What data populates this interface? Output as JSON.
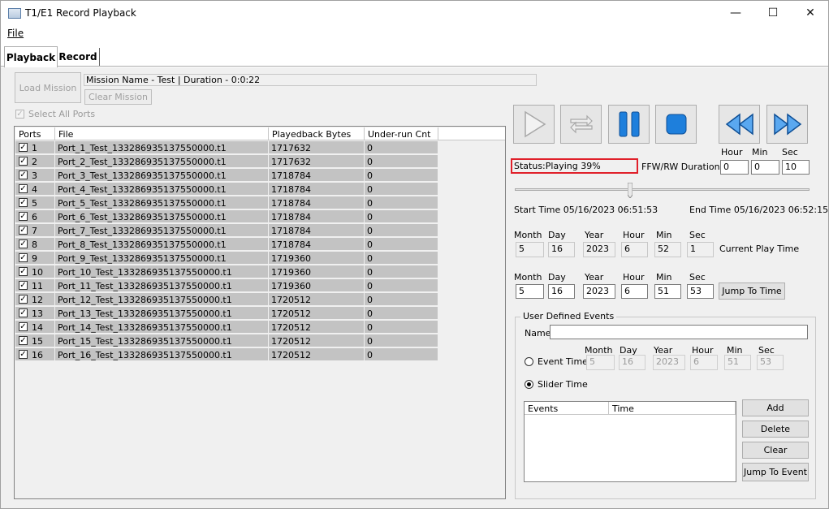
{
  "window": {
    "title": "T1/E1 Record Playback",
    "minimize": "—",
    "maximize": "☐",
    "close": "✕"
  },
  "menu": {
    "file": "File"
  },
  "tabs": [
    {
      "label": "Playback"
    },
    {
      "label": "Record"
    }
  ],
  "mission": {
    "load_button": "Load Mission",
    "info": "Mission Name - Test | Duration - 0:0:22",
    "clear_button": "Clear Mission",
    "select_all": "Select All Ports"
  },
  "ports_table": {
    "columns": [
      "Ports",
      "File",
      "Playedback Bytes",
      "Under-run Cnt"
    ],
    "rows": [
      {
        "port": "1",
        "file": "Port_1_Test_133286935137550000.t1",
        "bytes": "1717632",
        "underrun": "0"
      },
      {
        "port": "2",
        "file": "Port_2_Test_133286935137550000.t1",
        "bytes": "1717632",
        "underrun": "0"
      },
      {
        "port": "3",
        "file": "Port_3_Test_133286935137550000.t1",
        "bytes": "1718784",
        "underrun": "0"
      },
      {
        "port": "4",
        "file": "Port_4_Test_133286935137550000.t1",
        "bytes": "1718784",
        "underrun": "0"
      },
      {
        "port": "5",
        "file": "Port_5_Test_133286935137550000.t1",
        "bytes": "1718784",
        "underrun": "0"
      },
      {
        "port": "6",
        "file": "Port_6_Test_133286935137550000.t1",
        "bytes": "1718784",
        "underrun": "0"
      },
      {
        "port": "7",
        "file": "Port_7_Test_133286935137550000.t1",
        "bytes": "1718784",
        "underrun": "0"
      },
      {
        "port": "8",
        "file": "Port_8_Test_133286935137550000.t1",
        "bytes": "1718784",
        "underrun": "0"
      },
      {
        "port": "9",
        "file": "Port_9_Test_133286935137550000.t1",
        "bytes": "1719360",
        "underrun": "0"
      },
      {
        "port": "10",
        "file": "Port_10_Test_133286935137550000.t1",
        "bytes": "1719360",
        "underrun": "0"
      },
      {
        "port": "11",
        "file": "Port_11_Test_133286935137550000.t1",
        "bytes": "1719360",
        "underrun": "0"
      },
      {
        "port": "12",
        "file": "Port_12_Test_133286935137550000.t1",
        "bytes": "1720512",
        "underrun": "0"
      },
      {
        "port": "13",
        "file": "Port_13_Test_133286935137550000.t1",
        "bytes": "1720512",
        "underrun": "0"
      },
      {
        "port": "14",
        "file": "Port_14_Test_133286935137550000.t1",
        "bytes": "1720512",
        "underrun": "0"
      },
      {
        "port": "15",
        "file": "Port_15_Test_133286935137550000.t1",
        "bytes": "1720512",
        "underrun": "0"
      },
      {
        "port": "16",
        "file": "Port_16_Test_133286935137550000.t1",
        "bytes": "1720512",
        "underrun": "0"
      }
    ]
  },
  "transport": {
    "icons": [
      "play-icon",
      "loop-icon",
      "pause-icon",
      "stop-icon",
      "rewind-icon",
      "fast-forward-icon"
    ],
    "accent_color": "#1e7fdc"
  },
  "status": {
    "text": "Status:Playing 39%",
    "border_color": "#e0202a"
  },
  "ffw": {
    "label": "FFW/RW Duration",
    "headers": {
      "hour": "Hour",
      "min": "Min",
      "sec": "Sec"
    },
    "hour": "0",
    "min": "0",
    "sec": "10"
  },
  "slider": {
    "position_fraction": 0.39
  },
  "times": {
    "start": "Start Time 05/16/2023 06:51:53",
    "end": "End Time 05/16/2023 06:52:15"
  },
  "date_headers": {
    "month": "Month",
    "day": "Day",
    "year": "Year",
    "hour": "Hour",
    "min": "Min",
    "sec": "Sec"
  },
  "current_play": {
    "month": "5",
    "day": "16",
    "year": "2023",
    "hour": "6",
    "min": "52",
    "sec": "1",
    "label": "Current Play Time"
  },
  "jump": {
    "month": "5",
    "day": "16",
    "year": "2023",
    "hour": "6",
    "min": "51",
    "sec": "53",
    "button": "Jump To Time"
  },
  "events": {
    "group_title": "User Defined Events",
    "name_label": "Name",
    "name_value": "",
    "event_time_label": "Event Time",
    "slider_time_label": "Slider Time",
    "event_time": {
      "month": "5",
      "day": "16",
      "year": "2023",
      "hour": "6",
      "min": "51",
      "sec": "53"
    },
    "columns": [
      "Events",
      "Time"
    ],
    "buttons": {
      "add": "Add",
      "delete": "Delete",
      "clear": "Clear",
      "jump": "Jump To Event"
    }
  }
}
